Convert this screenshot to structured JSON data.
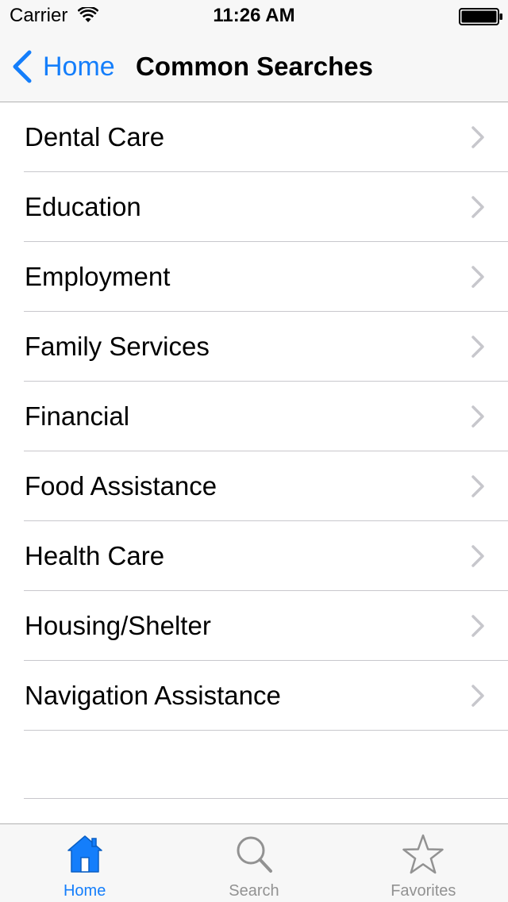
{
  "status_bar": {
    "carrier": "Carrier",
    "time": "11:26 AM",
    "wifi_icon": "wifi-icon",
    "battery_icon": "battery-icon"
  },
  "nav_bar": {
    "back_label": "Home",
    "back_icon": "chevron-left-icon",
    "title": "Common Searches"
  },
  "list": {
    "items": [
      {
        "label": "Dental Care"
      },
      {
        "label": "Education"
      },
      {
        "label": "Employment"
      },
      {
        "label": "Family Services"
      },
      {
        "label": "Financial"
      },
      {
        "label": "Food Assistance"
      },
      {
        "label": "Health Care"
      },
      {
        "label": "Housing/Shelter"
      },
      {
        "label": "Navigation Assistance"
      }
    ],
    "accessory_icon": "chevron-right-icon"
  },
  "tab_bar": {
    "tabs": [
      {
        "label": "Home",
        "icon": "home-icon",
        "active": true
      },
      {
        "label": "Search",
        "icon": "magnifier-icon",
        "active": false
      },
      {
        "label": "Favorites",
        "icon": "star-icon",
        "active": false
      }
    ]
  },
  "colors": {
    "accent": "#147efb",
    "inactive": "#929292",
    "bar_background": "#f7f7f7",
    "separator": "#c8c7cc"
  }
}
